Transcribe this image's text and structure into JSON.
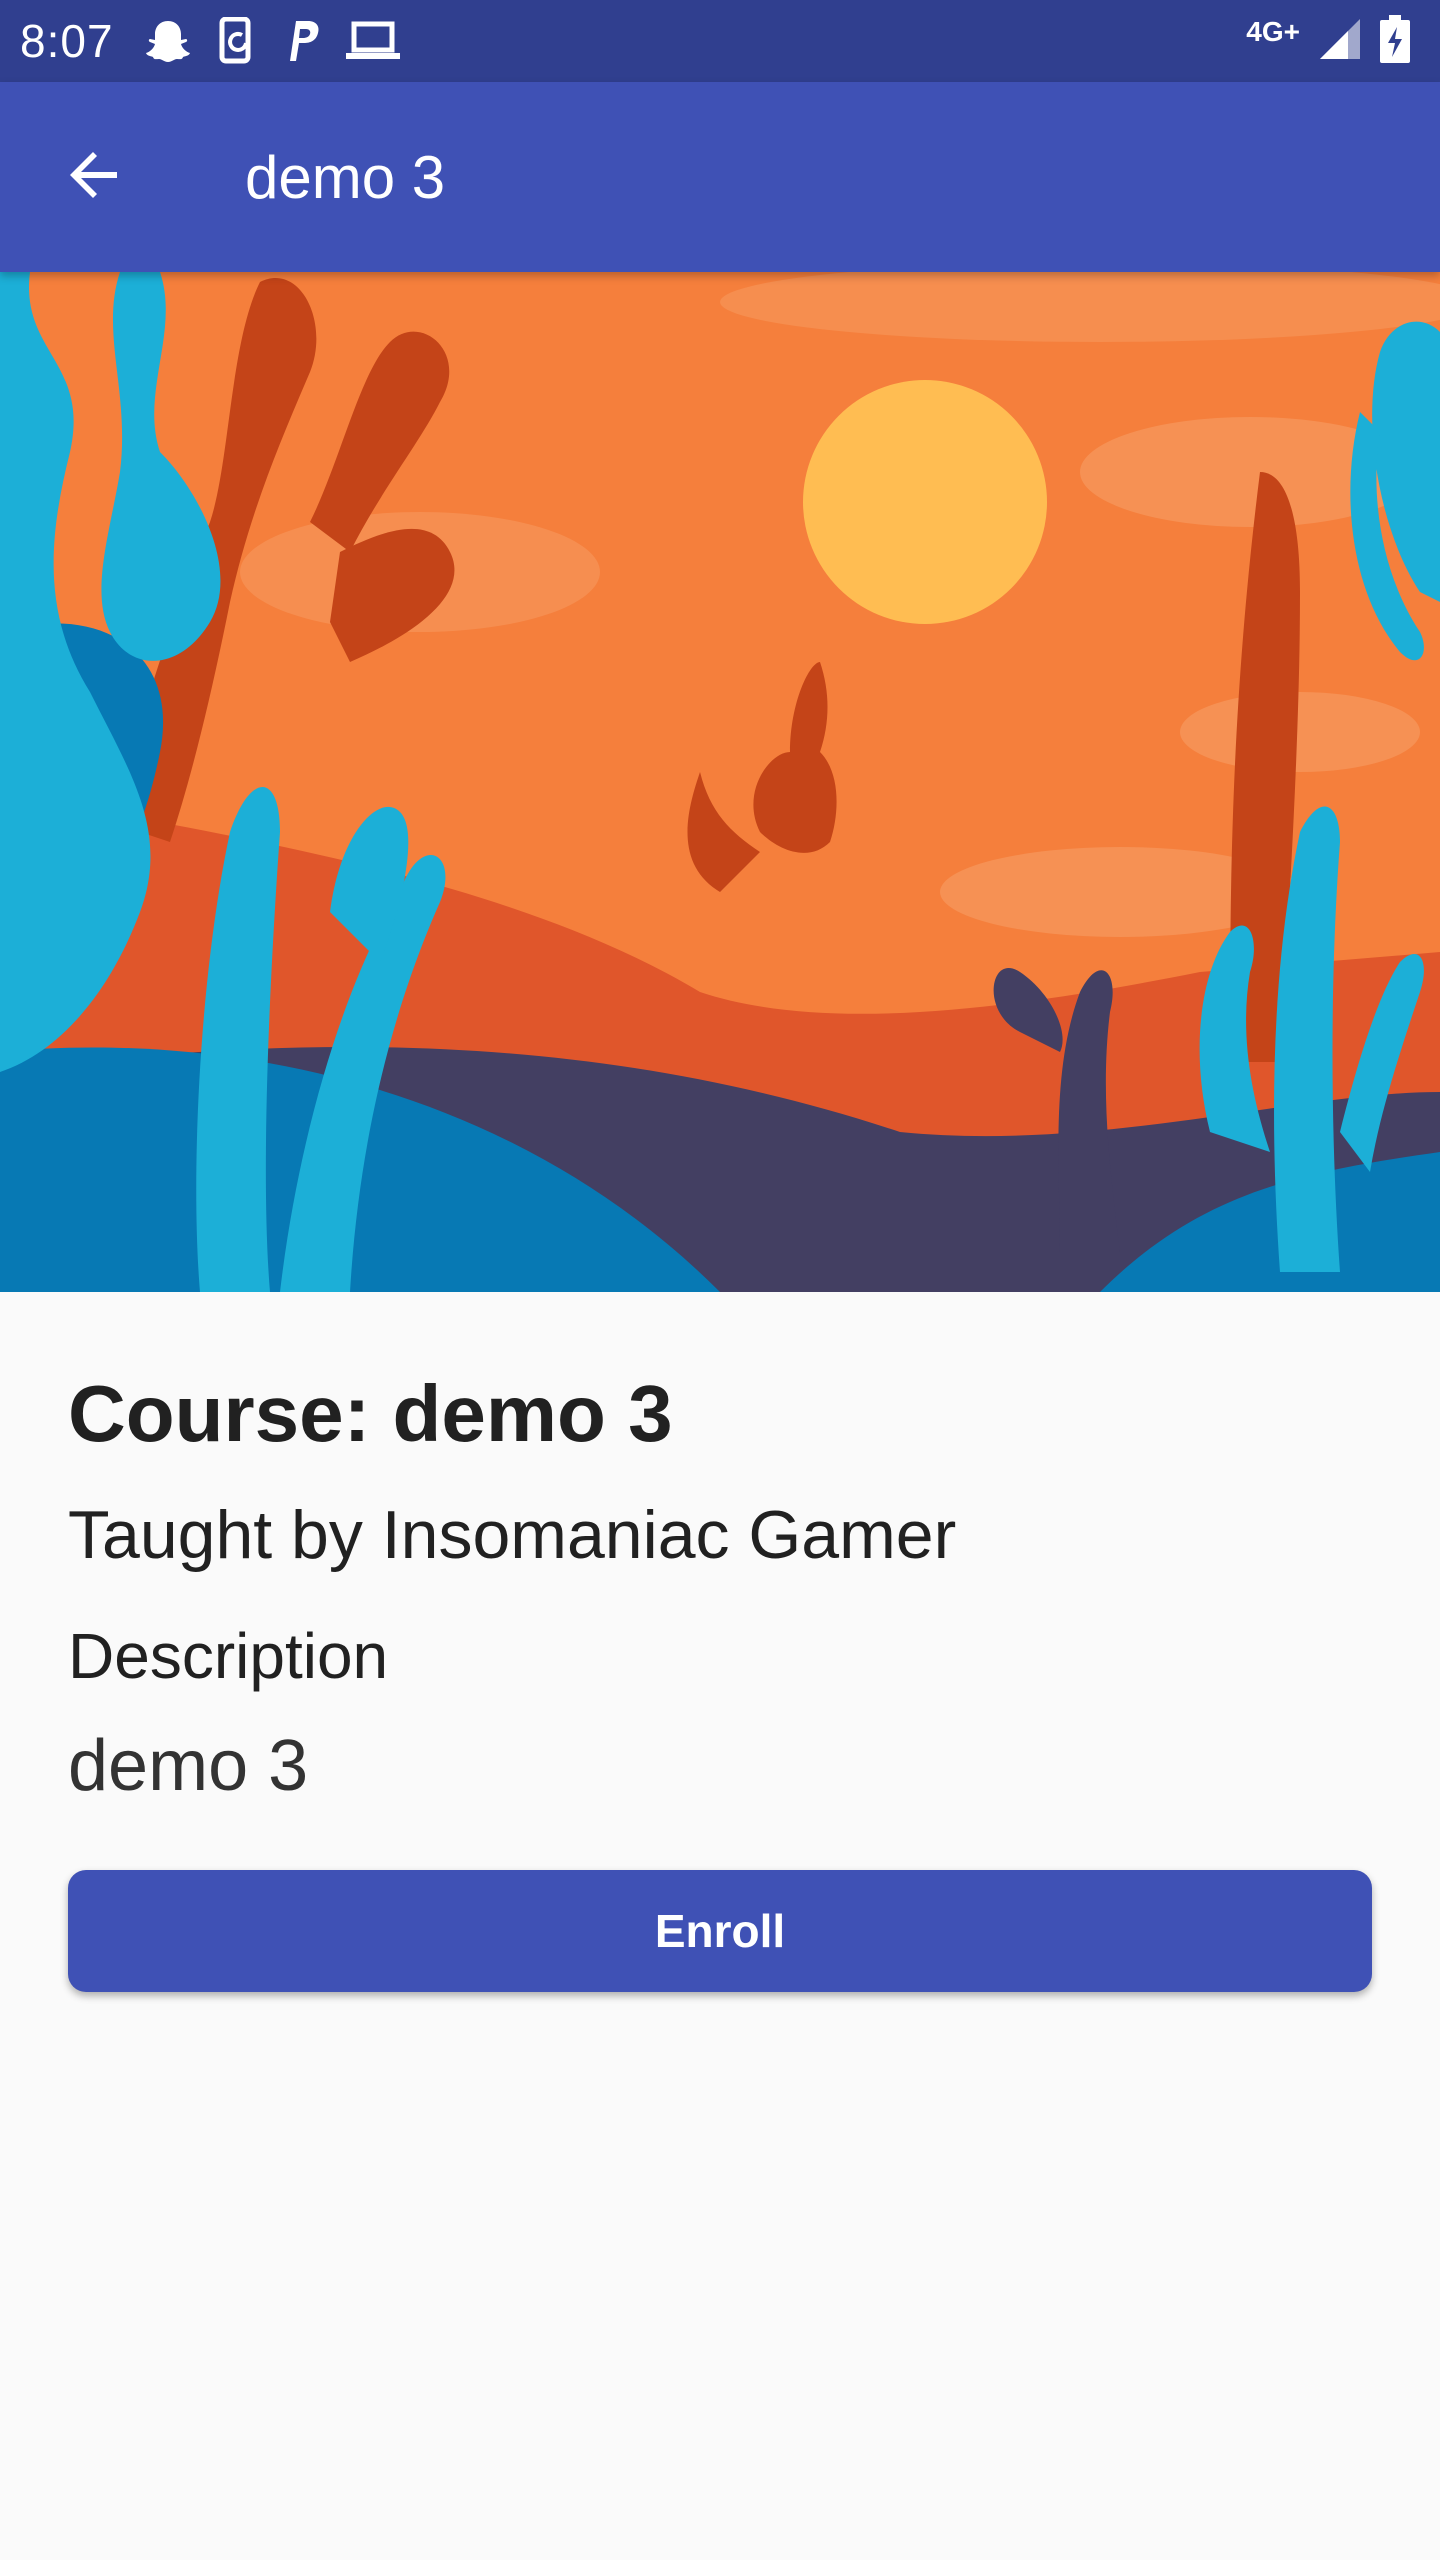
{
  "status_bar": {
    "time": "8:07",
    "network": "4G+",
    "icons": [
      "snapchat-icon",
      "phone-sync-icon",
      "paypal-icon",
      "laptop-icon",
      "signal-icon",
      "battery-charging-icon"
    ]
  },
  "app_bar": {
    "title": "demo 3",
    "back_icon": "arrow-back-icon",
    "color": "#3f51b5"
  },
  "hero": {
    "illustration": "desert-coyote-illustration"
  },
  "course": {
    "title": "Course: demo 3",
    "instructor": "Taught by Insomaniac Gamer",
    "description_heading": "Description",
    "description": "demo 3"
  },
  "actions": {
    "enroll_label": "Enroll"
  },
  "colors": {
    "primary": "#3f51b5",
    "primary_dark": "#303f8f",
    "background": "#fafafa"
  }
}
